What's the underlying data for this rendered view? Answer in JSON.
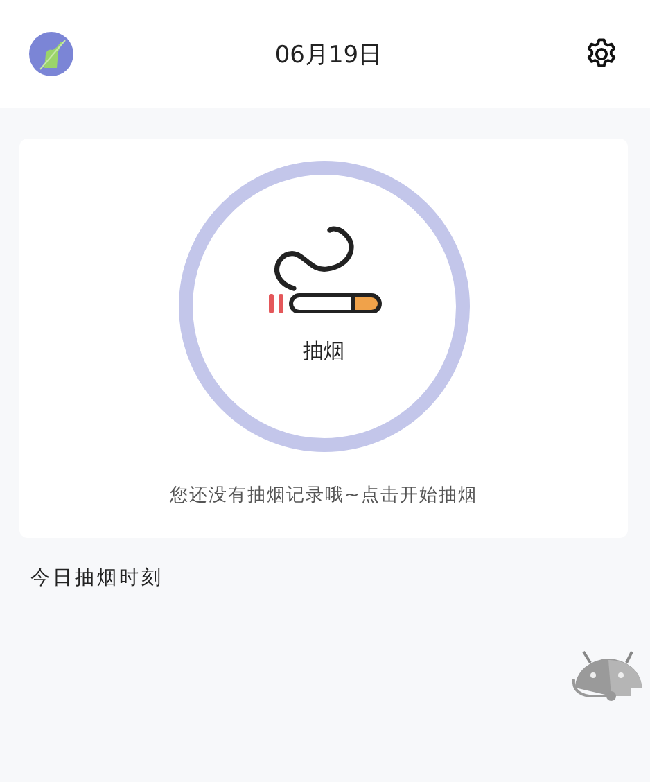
{
  "header": {
    "date": "06月19日"
  },
  "smoke_button": {
    "label": "抽烟"
  },
  "empty_message": "您还没有抽烟记录哦~点击开始抽烟",
  "section_title": "今日抽烟时刻"
}
